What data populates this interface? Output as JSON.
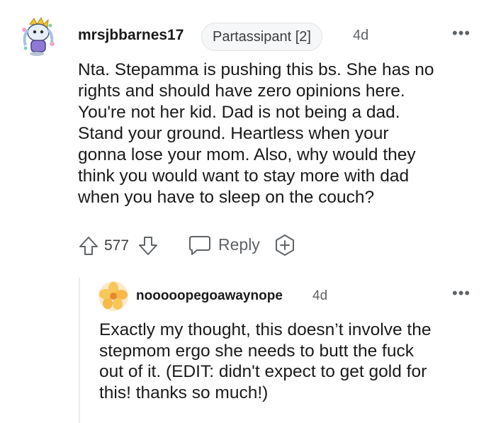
{
  "comment": {
    "avatar_icon": "snoo-avatar-icon",
    "username": "mrsjbbarnes17",
    "flair": "Partassipant [2]",
    "age": "4d",
    "more_icon": "•••",
    "body_lines": [
      "Nta. Stepamma is pushing this bs. She has no",
      "rights and should have zero opinions here.",
      "You're not her kid. Dad is not being a dad.",
      "Stand your ground. Heartless when your",
      "gonna lose your mom. Also, why would they",
      "think you would want to stay more with dad",
      "when you have to sleep on the couch?"
    ],
    "score": "577",
    "reply_label": "Reply"
  },
  "reply": {
    "avatar_icon": "flower-avatar-icon",
    "username": "nooooopegoawaynope",
    "age": "4d",
    "more_icon": "•••",
    "body_lines": [
      "Exactly my thought, this doesn’t involve the",
      "stepmom ergo she needs to butt the fuck",
      "out of it. (EDIT: didn't expect to get gold for",
      "this! thanks so much!)"
    ]
  },
  "colors": {
    "text": "#1a1a1b",
    "meta": "#5f6468",
    "flair_bg": "#f6f7f8",
    "flair_border": "#e1e3e5",
    "thread_line": "#e9eaeb"
  }
}
